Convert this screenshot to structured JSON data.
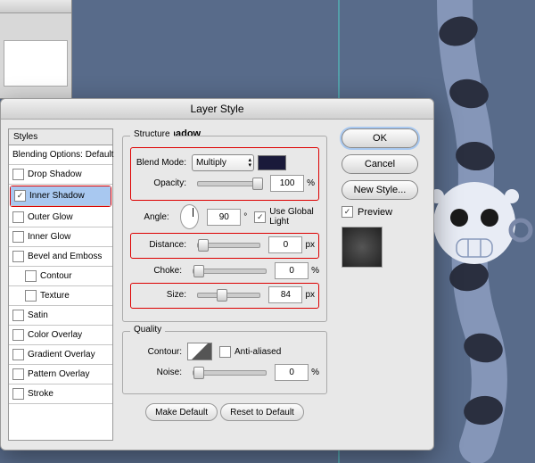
{
  "dialog": {
    "title": "Layer Style",
    "section_title": "Inner Shadow"
  },
  "styles": {
    "header": "Styles",
    "items": [
      {
        "label": "Blending Options: Default",
        "checked": null
      },
      {
        "label": "Drop Shadow",
        "checked": false
      },
      {
        "label": "Inner Shadow",
        "checked": true,
        "selected": true
      },
      {
        "label": "Outer Glow",
        "checked": false
      },
      {
        "label": "Inner Glow",
        "checked": false
      },
      {
        "label": "Bevel and Emboss",
        "checked": false
      },
      {
        "label": "Contour",
        "checked": false,
        "indent": true
      },
      {
        "label": "Texture",
        "checked": false,
        "indent": true
      },
      {
        "label": "Satin",
        "checked": false
      },
      {
        "label": "Color Overlay",
        "checked": false
      },
      {
        "label": "Gradient Overlay",
        "checked": false
      },
      {
        "label": "Pattern Overlay",
        "checked": false
      },
      {
        "label": "Stroke",
        "checked": false
      }
    ]
  },
  "structure": {
    "legend": "Structure",
    "blend_mode_label": "Blend Mode:",
    "blend_mode_value": "Multiply",
    "opacity_label": "Opacity:",
    "opacity_value": "100",
    "percent": "%",
    "angle_label": "Angle:",
    "angle_value": "90",
    "degree": "°",
    "global_light_label": "Use Global Light",
    "global_light_checked": true,
    "distance_label": "Distance:",
    "distance_value": "0",
    "px": "px",
    "choke_label": "Choke:",
    "choke_value": "0",
    "size_label": "Size:",
    "size_value": "84"
  },
  "quality": {
    "legend": "Quality",
    "contour_label": "Contour:",
    "antialiased_label": "Anti-aliased",
    "antialiased_checked": false,
    "noise_label": "Noise:",
    "noise_value": "0"
  },
  "buttons": {
    "make_default": "Make Default",
    "reset_default": "Reset to Default",
    "ok": "OK",
    "cancel": "Cancel",
    "new_style": "New Style...",
    "preview": "Preview",
    "preview_checked": true
  }
}
